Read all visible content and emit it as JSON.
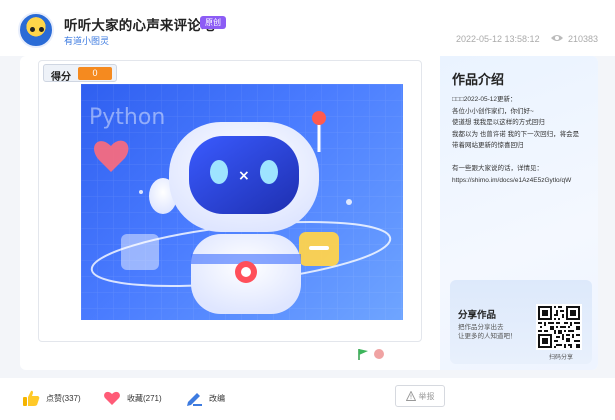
{
  "header": {
    "title": "听听大家的心声来评论吧",
    "badge": "原创",
    "author": "有道小图灵",
    "date": "2022-05-12 13:58:12",
    "views": "210383"
  },
  "stage": {
    "score_label": "得分",
    "score_value": "0",
    "artwork_text": "Python"
  },
  "intro": {
    "title": "作品介绍",
    "lines": [
      "□□□2022-05-12更新：",
      "各位小小创作家们，你们好~",
      "使道想 我我是以这样的方式回归",
      "我都以为 也曾许诺 我的下一次回归，将会是",
      "带着网站更新的惊喜回归",
      "",
      "有一些跟大家说的话，详情见：",
      "https://shimo.im/docs/e1Az4E5zGytlo/qW"
    ]
  },
  "share": {
    "title": "分享作品",
    "sub1": "把作品分享出去",
    "sub2": "让更多的人知道吧！",
    "qr_caption": "扫码分享"
  },
  "actions": {
    "like": "点赞(337)",
    "favorite": "收藏(271)",
    "edit": "改编",
    "report": "举报"
  },
  "colors": {
    "accent": "#3d7be0",
    "badge": "#8c5cf5",
    "score": "#f58a1f"
  }
}
